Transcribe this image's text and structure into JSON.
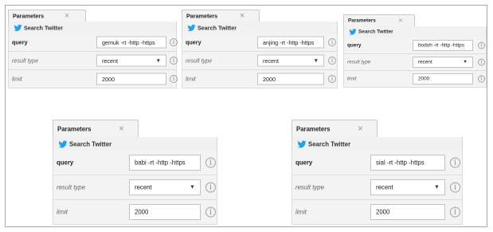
{
  "panels": [
    {
      "tab_title": "Parameters",
      "close_glyph": "×",
      "section_title": "Search Twitter",
      "icon": "twitter-bird-icon",
      "query_label": "query",
      "query_value": "gemuk -rt -http -https",
      "result_type_label": "result type",
      "result_type_value": "recent",
      "limit_label": "limit",
      "limit_value": "2000",
      "info_glyph": "i"
    },
    {
      "tab_title": "Parameters",
      "close_glyph": "×",
      "section_title": "Search Twitter",
      "icon": "twitter-bird-icon",
      "query_label": "query",
      "query_value": "anjing -rt -http -https",
      "result_type_label": "result type",
      "result_type_value": "recent",
      "limit_label": "limit",
      "limit_value": "2000",
      "info_glyph": "i"
    },
    {
      "tab_title": "Parameters",
      "close_glyph": "×",
      "section_title": "Search Twitter",
      "icon": "twitter-bird-icon",
      "query_label": "query",
      "query_value": "bodoh -rt -http -https",
      "result_type_label": "result type",
      "result_type_value": "recent",
      "limit_label": "limit",
      "limit_value": "2000",
      "info_glyph": "i"
    },
    {
      "tab_title": "Parameters",
      "close_glyph": "×",
      "section_title": "Search Twitter",
      "icon": "twitter-bird-icon",
      "query_label": "query",
      "query_value": "babi -rt -http -https",
      "result_type_label": "result type",
      "result_type_value": "recent",
      "limit_label": "limit",
      "limit_value": "2000",
      "info_glyph": "i"
    },
    {
      "tab_title": "Parameters",
      "close_glyph": "×",
      "section_title": "Search Twitter",
      "icon": "twitter-bird-icon",
      "query_label": "query",
      "query_value": "sial -rt -http -https",
      "result_type_label": "result type",
      "result_type_value": "recent",
      "limit_label": "limit",
      "limit_value": "2000",
      "info_glyph": "i"
    }
  ],
  "colors": {
    "twitter_blue": "#1da1f2",
    "row_bg": "#f3f3f3",
    "border": "#c9c9c9"
  }
}
